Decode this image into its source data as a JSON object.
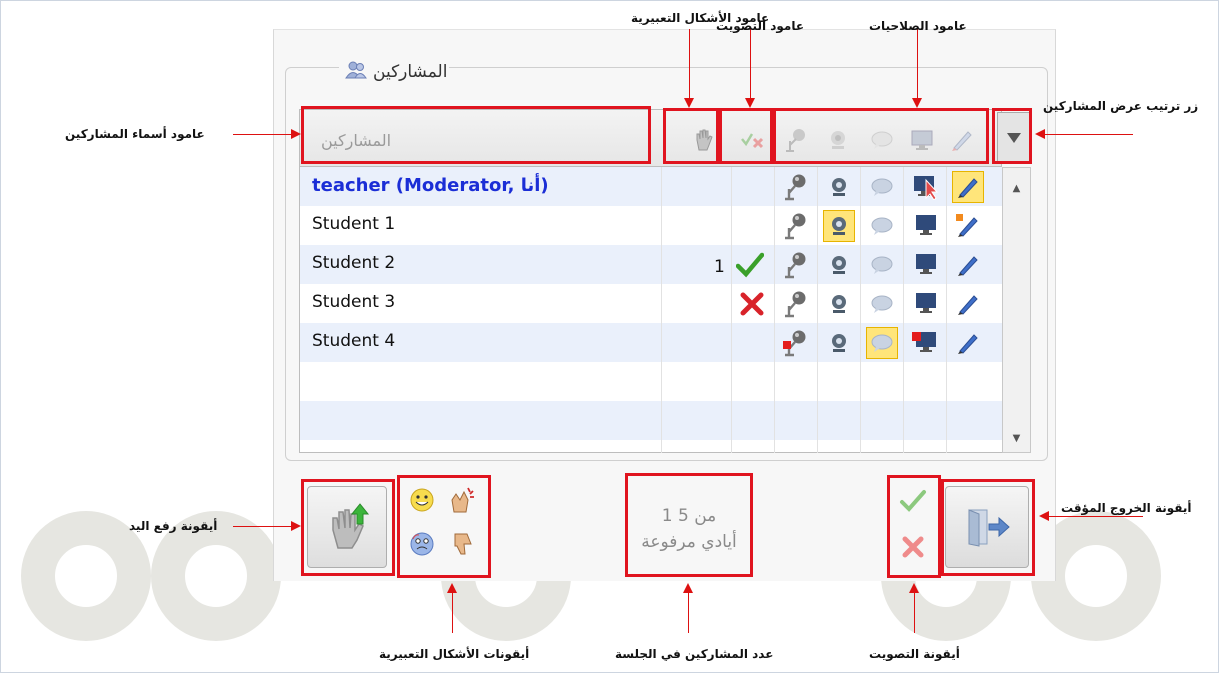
{
  "panel": {
    "title": "المشاركين",
    "title_icon": "participants-icon",
    "names_header": "المشاركين"
  },
  "participants": [
    {
      "name": "teacher (Moderator, أنا)",
      "moderator": true,
      "vote": "",
      "vote_count": ""
    },
    {
      "name": "Student 1",
      "moderator": false,
      "vote": "",
      "vote_count": ""
    },
    {
      "name": "Student 2",
      "moderator": false,
      "vote": "yes",
      "vote_count": "1"
    },
    {
      "name": "Student 3",
      "moderator": false,
      "vote": "no",
      "vote_count": ""
    },
    {
      "name": "Student 4",
      "moderator": false,
      "vote": "",
      "vote_count": ""
    }
  ],
  "status": {
    "count_line1": "1 من 5",
    "count_line2": "أيادي مرفوعة"
  },
  "annotations": {
    "emoticons_column": "عامود الأشكال التعبيرية",
    "voting_column": "عامود التصويت",
    "permissions_column": "عامود  الصلاحيات",
    "sort_button": "زر ترتيب عرض المشاركين",
    "names_column": "عامود أسماء المشاركين",
    "raise_hand_icon": "أيقونة رفع اليد",
    "exit_icon": "أيقونة الخروج المؤقت",
    "emoticon_icons": "أيقونات الأشكال التعبيرية",
    "participant_count": "عدد المشاركين في الجلسة",
    "voting_icons": "أيقونة التصويت"
  },
  "colors": {
    "highlight_red": "#e0141f",
    "moderator_blue": "#1b2ed6",
    "row_alt": "#eaf0fb",
    "watermark": "#e6e6e1"
  }
}
